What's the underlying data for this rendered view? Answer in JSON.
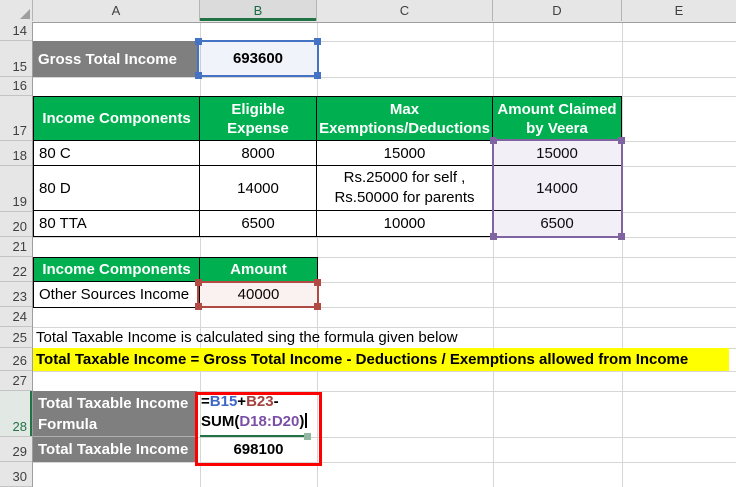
{
  "sheet": {
    "column_headers": [
      "A",
      "B",
      "C",
      "D",
      "E"
    ],
    "row_numbers": [
      "14",
      "15",
      "16",
      "17",
      "18",
      "19",
      "20",
      "21",
      "22",
      "23",
      "24",
      "25",
      "26",
      "27",
      "28",
      "29",
      "30"
    ],
    "selected_column": "B",
    "selected_row": "28"
  },
  "gross_row": {
    "label": "Gross Total Income",
    "value": "693600"
  },
  "deductions_table": {
    "headers": [
      "Income Components",
      "Eligible Expense",
      "Max Exemptions/Deductions",
      "Amount Claimed by Veera"
    ],
    "rows": [
      {
        "component": "80 C",
        "eligible_expense": "8000",
        "max_exemption": "15000",
        "amount_claimed": "15000"
      },
      {
        "component": "80 D",
        "eligible_expense": "14000",
        "max_exemption": "Rs.25000 for self ,\nRs.50000 for parents",
        "amount_claimed": "14000"
      },
      {
        "component": "80 TTA",
        "eligible_expense": "6500",
        "max_exemption": "10000",
        "amount_claimed": "6500"
      }
    ]
  },
  "other_income_table": {
    "headers": [
      "Income Components",
      "Amount"
    ],
    "rows": [
      {
        "component": "Other Sources Income",
        "amount": "40000"
      }
    ]
  },
  "note": "Total Taxable Income is calculated sing the formula given below",
  "definition": "Total Taxable Income = Gross Total Income - Deductions / Exemptions allowed from Income",
  "formula_cell": {
    "label": "Total Taxable Income Formula",
    "segments": {
      "eq": "=",
      "ref1": "B15",
      "op1": "+",
      "ref2": "B23",
      "op2": "-",
      "func": "SUM(",
      "range": "D18:D20",
      "close": ")"
    }
  },
  "result_row": {
    "label": "Total Taxable Income",
    "value": "698100"
  },
  "colors": {
    "green": "#00B050",
    "label_gray": "#7F7F7F",
    "yellow": "#FFFF00",
    "annotation_red": "#FF0000",
    "sel_blue": "#4472C4",
    "sel_red": "#B04A42",
    "sel_purple": "#8064A2",
    "ref_blue": "#3E66C4",
    "ref_red": "#A5413E",
    "ref_purple": "#7B4FA6",
    "edit_green": "#217346",
    "header_bg": "#E6E6E6",
    "gridline": "#D6D6D6"
  }
}
